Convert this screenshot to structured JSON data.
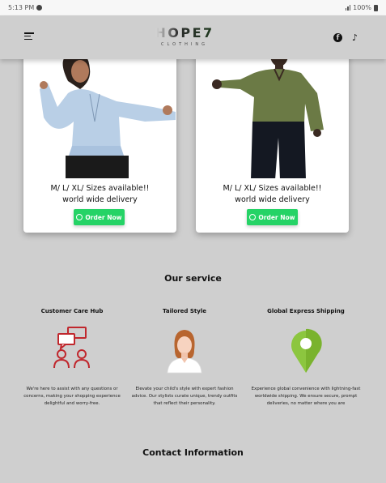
{
  "status_bar": {
    "time": "5:13 PM",
    "battery": "100%"
  },
  "brand": {
    "logo_main": "HOPE7",
    "logo_sub": "CLOTHING"
  },
  "products": [
    {
      "line1": "M/ L/ XL/ Sizes available!!",
      "line2": "world wide delivery",
      "button": "Order Now"
    },
    {
      "line1": "M/ L/ XL/ Sizes available!!",
      "line2": "world wide delivery",
      "button": "Order Now"
    }
  ],
  "services": {
    "heading": "Our service",
    "items": [
      {
        "title": "Customer Care Hub",
        "icon": "customer-support-icon",
        "desc": "We're here to assist with any questions or concerns, making your shopping experience delightful and worry-free."
      },
      {
        "title": "Tailored Style",
        "icon": "stylist-avatar-icon",
        "desc": "Elevate your child's style with expert fashion advice. Our stylists curate unique, trendy outfits that reflect their personality."
      },
      {
        "title": "Global Express Shipping",
        "icon": "map-pin-icon",
        "desc": "Experience global convenience with lightning-fast worldwide shipping. We ensure secure, prompt deliveries, no matter where you are"
      }
    ]
  },
  "contact": {
    "heading": "Contact Information"
  },
  "colors": {
    "background": "#cfcfcf",
    "whatsapp_green": "#25d366",
    "support_red": "#c0272d",
    "pin_green": "#8cc63f"
  }
}
